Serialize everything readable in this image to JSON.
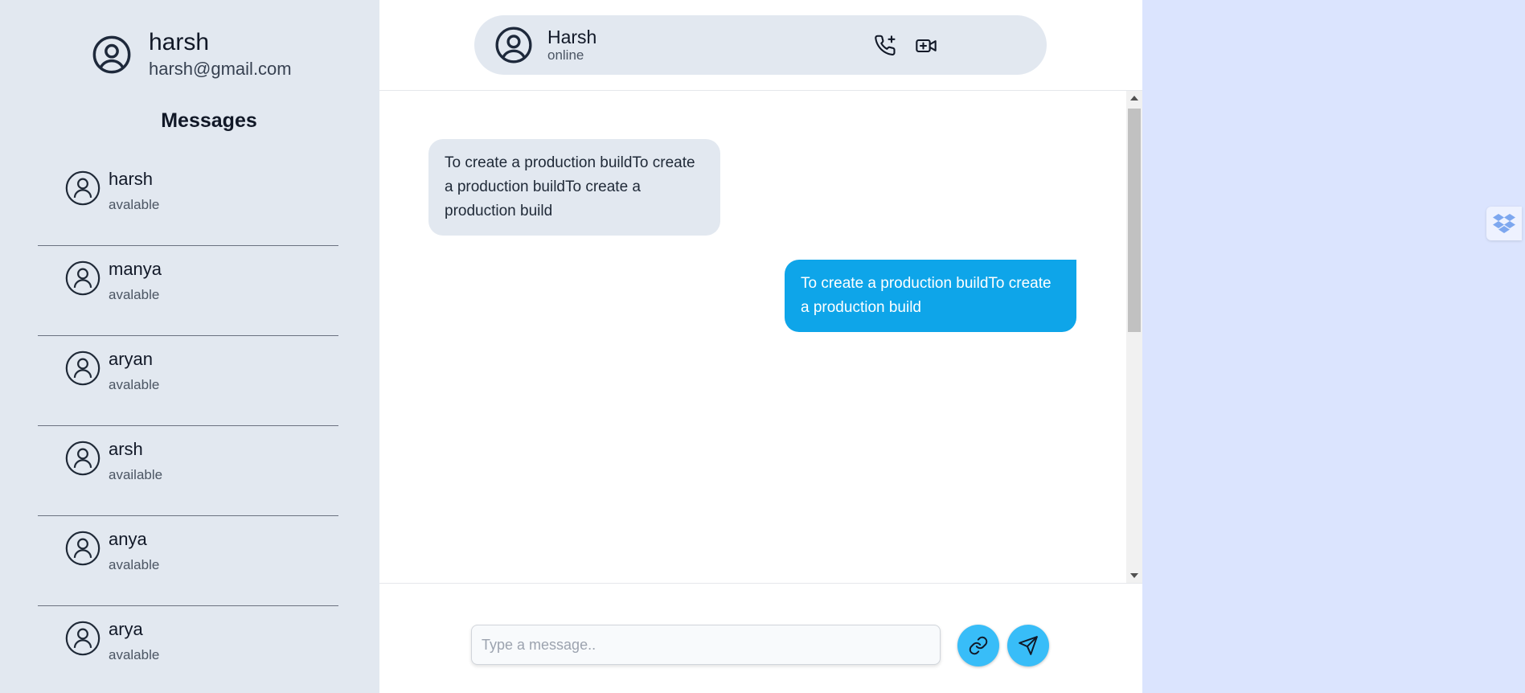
{
  "user": {
    "name": "harsh",
    "email": "harsh@gmail.com"
  },
  "sidebar": {
    "heading": "Messages",
    "contacts": [
      {
        "name": "harsh",
        "status": "avalable"
      },
      {
        "name": "manya",
        "status": "avalable"
      },
      {
        "name": "aryan",
        "status": "avalable"
      },
      {
        "name": "arsh",
        "status": "available"
      },
      {
        "name": "anya",
        "status": "avalable"
      },
      {
        "name": "arya",
        "status": "avalable"
      }
    ]
  },
  "chat": {
    "header": {
      "name": "Harsh",
      "status": "online"
    },
    "messages": [
      {
        "direction": "in",
        "text": "To create a production buildTo create a production buildTo create a production build"
      },
      {
        "direction": "out",
        "text": "To create a production buildTo create a production build"
      }
    ],
    "composer": {
      "placeholder": "Type a message..",
      "value": ""
    }
  },
  "icons": {
    "header_actions": [
      "phone-plus-icon",
      "video-plus-icon"
    ],
    "composer_actions": [
      "link-icon",
      "send-icon"
    ],
    "widget": "dropbox-icon"
  },
  "colors": {
    "sidebar_bg": "#e2e8f0",
    "outgoing_bubble": "#0ea5e9",
    "incoming_bubble": "#e2e8f0",
    "action_button": "#38bdf8",
    "right_panel_bg": "#dbe4fe"
  }
}
